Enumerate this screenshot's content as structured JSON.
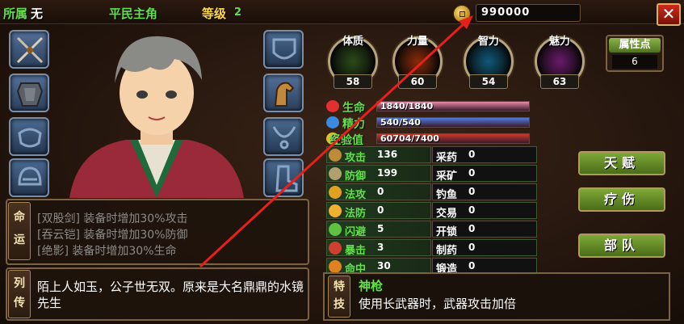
{
  "topbar": {
    "faction_label": "所属",
    "faction_value": "无",
    "rank": "平民主角",
    "level_label": "等级",
    "level_value": "2",
    "gold": "990000",
    "close": "✕"
  },
  "stats_orbs": [
    {
      "label": "体质",
      "value": "58",
      "color": "#2b4a1a"
    },
    {
      "label": "力量",
      "value": "60",
      "color": "#8a2a08"
    },
    {
      "label": "智力",
      "value": "54",
      "color": "#0f5a7a"
    },
    {
      "label": "魅力",
      "value": "63",
      "color": "#6a1a6a"
    }
  ],
  "attribute_points": {
    "label": "属性点",
    "value": "6"
  },
  "bars": [
    {
      "label": "生命",
      "text": "1840/1840",
      "fill_fraction": 1.0,
      "fill_color": "#e88aa8"
    },
    {
      "label": "精力",
      "text": "540/540",
      "fill_fraction": 1.0,
      "fill_color": "#4f7ae0"
    },
    {
      "label": "经验值",
      "text": "60704/7400",
      "fill_fraction": 1.0,
      "fill_color": "#c83a2a"
    }
  ],
  "combat_stats": [
    {
      "name": "攻击",
      "value": "136"
    },
    {
      "name": "防御",
      "value": "199"
    },
    {
      "name": "法攻",
      "value": "0"
    },
    {
      "name": "法防",
      "value": "0"
    },
    {
      "name": "闪避",
      "value": "5"
    },
    {
      "name": "暴击",
      "value": "3"
    },
    {
      "name": "命中",
      "value": "30"
    }
  ],
  "life_skills": [
    {
      "name": "采药",
      "value": "0"
    },
    {
      "name": "采矿",
      "value": "0"
    },
    {
      "name": "钓鱼",
      "value": "0"
    },
    {
      "name": "交易",
      "value": "0"
    },
    {
      "name": "开锁",
      "value": "0"
    },
    {
      "name": "制药",
      "value": "0"
    },
    {
      "name": "锻造",
      "value": "0"
    }
  ],
  "side_buttons": [
    "天赋",
    "疗伤",
    "部队"
  ],
  "destiny": {
    "tag": "命运",
    "lines": [
      "[双股剑] 装备时增加30%攻击",
      "[吞云铠] 装备时增加30%防御",
      "[绝影] 装备时增加30%生命"
    ]
  },
  "biography": {
    "tag": "列传",
    "text": "陌上人如玉，公子世无双。原来是大名鼎鼎的水镜先生"
  },
  "special": {
    "tag": "特技",
    "name": "神枪",
    "description": "使用长武器时，武器攻击加倍"
  },
  "colors": {
    "accent_green": "#63e04a",
    "level_gold": "#ffd84a",
    "arrow_red": "#e8201a"
  }
}
